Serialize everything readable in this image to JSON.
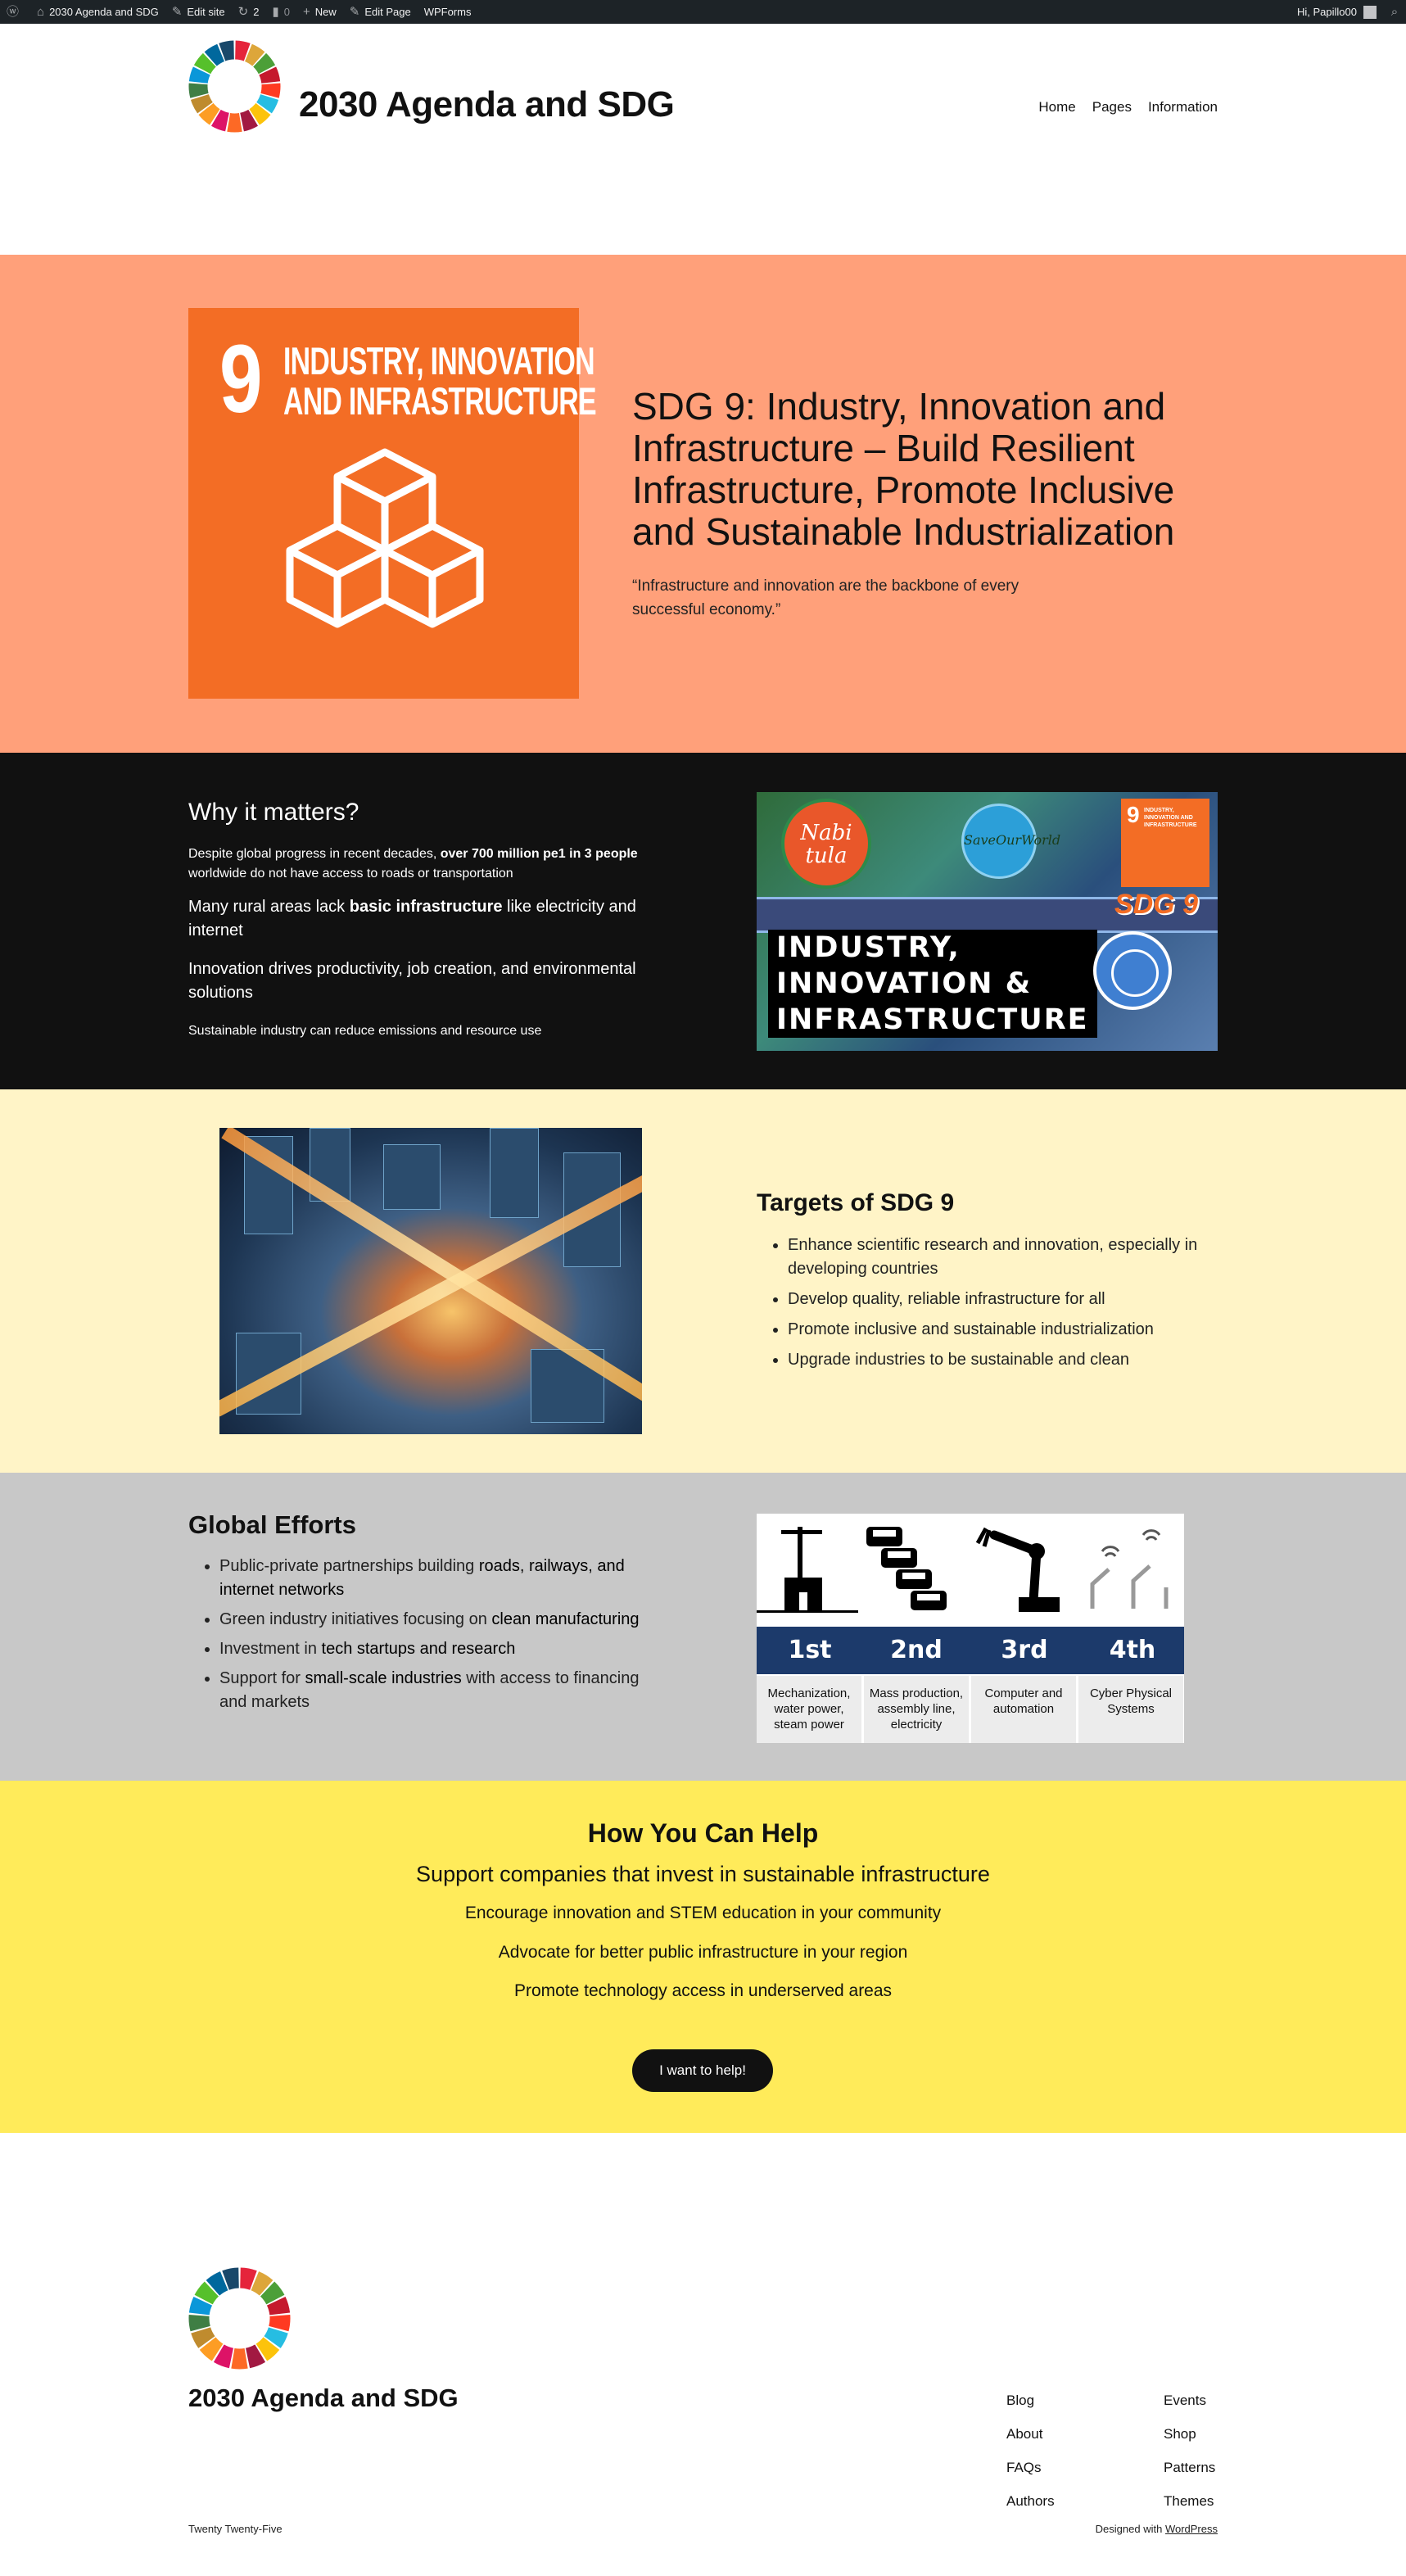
{
  "admin_bar": {
    "site_name": "2030 Agenda and SDG",
    "edit_site": "Edit site",
    "updates_count": "2",
    "comments_count": "0",
    "new": "New",
    "edit_page": "Edit Page",
    "wpforms": "WPForms",
    "greeting": "Hi, Papillo00",
    "icons": [
      "wordpress-icon",
      "home-icon",
      "edit-icon",
      "updates-icon",
      "comments-icon",
      "plus-icon",
      "pencil-icon",
      "search-icon"
    ]
  },
  "header": {
    "title": "2030 Agenda and SDG",
    "nav": [
      "Home",
      "Pages",
      "Information"
    ]
  },
  "hero": {
    "tile_number": "9",
    "tile_label_line1": "INDUSTRY, INNOVATION",
    "tile_label_line2": "AND INFRASTRUCTURE",
    "title": "SDG 9: Industry, Innovation and Infrastructure – Build Resilient Infrastructure, Promote Inclusive and Sustainable Industrialization",
    "quote": "“Infrastructure and innovation are the backbone of every successful economy.”",
    "tile_color": "#f36d25",
    "background": "#ffa07a"
  },
  "why": {
    "heading": "Why it matters?",
    "p1_a": "Despite global progress in recent decades, ",
    "p1_b": "over 700 million pe1 in 3 people",
    "p1_c": " worldwide do not have access to roads or transportation",
    "p2_a": "Many rural areas lack ",
    "p2_b": "basic infrastructure",
    "p2_c": " like electricity and internet",
    "p3": "Innovation drives productivity, job creation, and environmental solutions",
    "p4": "Sustainable industry can reduce emissions and resource use",
    "banner": {
      "circle_text_1": "Nabi",
      "circle_text_2": "tula",
      "globe_text": "SaveOurWorld",
      "tile_number": "9",
      "tile_text": "INDUSTRY, INNOVATION AND INFRASTRUCTURE",
      "sdg": "SDG 9",
      "line1": "INDUSTRY,",
      "line2": "INNOVATION &",
      "line3": "INFRASTRUCTURE"
    }
  },
  "targets": {
    "heading": "Targets of SDG 9",
    "items": [
      "Enhance scientific research and innovation, especially in developing countries",
      "Develop quality, reliable infrastructure for all",
      "Promote inclusive and sustainable industrialization",
      "Upgrade industries to be sustainable and clean"
    ]
  },
  "efforts": {
    "heading": "Global Efforts",
    "items": [
      {
        "a": "Public-private partnerships building ",
        "b": "roads, railways, and internet networks",
        "c": ""
      },
      {
        "a": "Green industry initiatives focusing on ",
        "b": "clean manufacturing",
        "c": ""
      },
      {
        "a": "Investment in ",
        "b": "tech startups and research",
        "c": ""
      },
      {
        "a": "Support for ",
        "b": "small-scale industries",
        "c": " with access to financing and markets"
      }
    ],
    "revolutions": [
      {
        "label": "1st",
        "caption": "Mechanization, water power, steam power"
      },
      {
        "label": "2nd",
        "caption": "Mass production, assembly line, electricity"
      },
      {
        "label": "3rd",
        "caption": "Computer and automation"
      },
      {
        "label": "4th",
        "caption": "Cyber Physical Systems"
      }
    ]
  },
  "help": {
    "heading": "How You Can Help",
    "line1": "Support companies that invest in sustainable infrastructure",
    "line2": "Encourage innovation and STEM education in your community",
    "line3": "Advocate for better public infrastructure in your region",
    "line4": "Promote technology access in underserved areas",
    "button": "I want to help!"
  },
  "footer": {
    "title": "2030 Agenda and SDG",
    "col1": [
      "Blog",
      "About",
      "FAQs",
      "Authors"
    ],
    "col2": [
      "Events",
      "Shop",
      "Patterns",
      "Themes"
    ],
    "theme": "Twenty Twenty-Five",
    "designed_prefix": "Designed with ",
    "designed_link": "WordPress"
  },
  "colors": {
    "sdg_wheel": [
      "#e5243b",
      "#dda63a",
      "#4c9f38",
      "#c5192d",
      "#ff3a21",
      "#26bde2",
      "#fcc30b",
      "#a21942",
      "#fd6925",
      "#dd1367",
      "#fd9d24",
      "#bf8b2e",
      "#3f7e44",
      "#0a97d9",
      "#56c02b",
      "#00689d",
      "#19486a"
    ],
    "why_bg": "#111111",
    "targets_bg": "#fff4c7",
    "efforts_bg": "#c8c8c8",
    "help_bg": "#ffeb5a"
  }
}
